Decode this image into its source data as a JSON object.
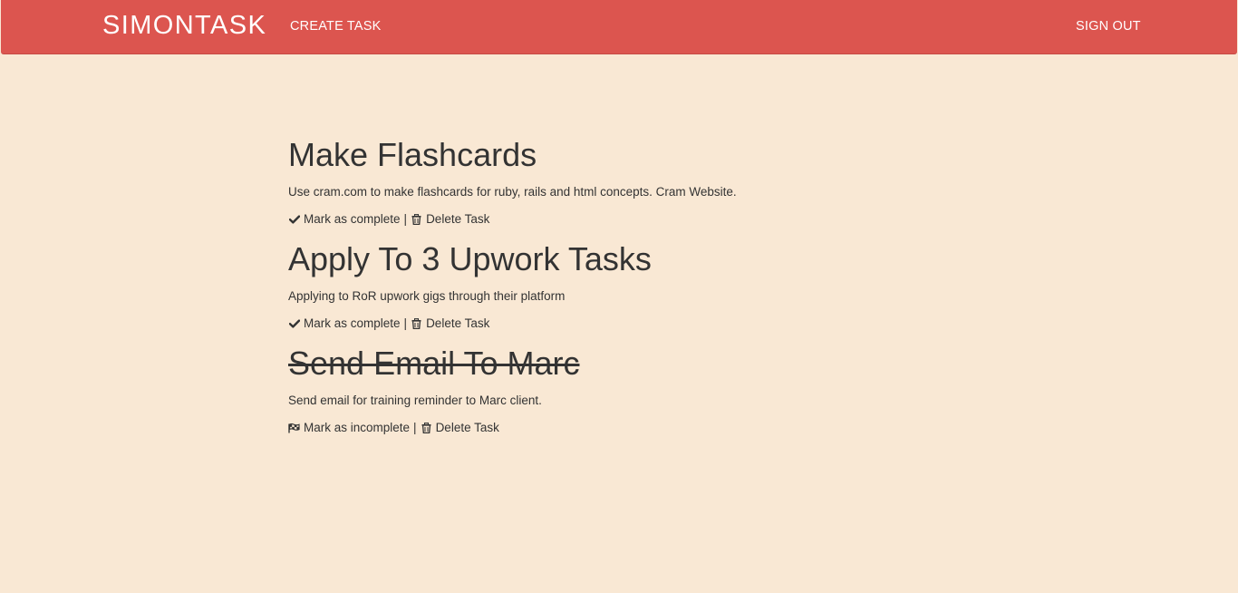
{
  "navbar": {
    "brand": "SIMONTASK",
    "create_link": "CREATE TASK",
    "signout_link": "SIGN OUT",
    "background_color": "#dc554f"
  },
  "tasks": [
    {
      "title": "Make Flashcards",
      "description": "Use cram.com to make flashcards for ruby, rails and html concepts. Cram Website.",
      "completed": false,
      "toggle_icon": "check-icon",
      "toggle_label": "Mark as complete",
      "separator": "|",
      "delete_icon": "trash-icon",
      "delete_label": "Delete Task"
    },
    {
      "title": "Apply To 3 Upwork Tasks",
      "description": "Applying to RoR upwork gigs through their platform",
      "completed": false,
      "toggle_icon": "check-icon",
      "toggle_label": "Mark as complete",
      "separator": "|",
      "delete_icon": "trash-icon",
      "delete_label": "Delete Task"
    },
    {
      "title": "Send Email To Marc",
      "description": "Send email for training reminder to Marc client.",
      "completed": true,
      "toggle_icon": "flag-icon",
      "toggle_label": "Mark as incomplete",
      "separator": "|",
      "delete_icon": "trash-icon",
      "delete_label": "Delete Task"
    }
  ],
  "colors": {
    "page_background": "#f9e8d4",
    "text": "#333333"
  }
}
